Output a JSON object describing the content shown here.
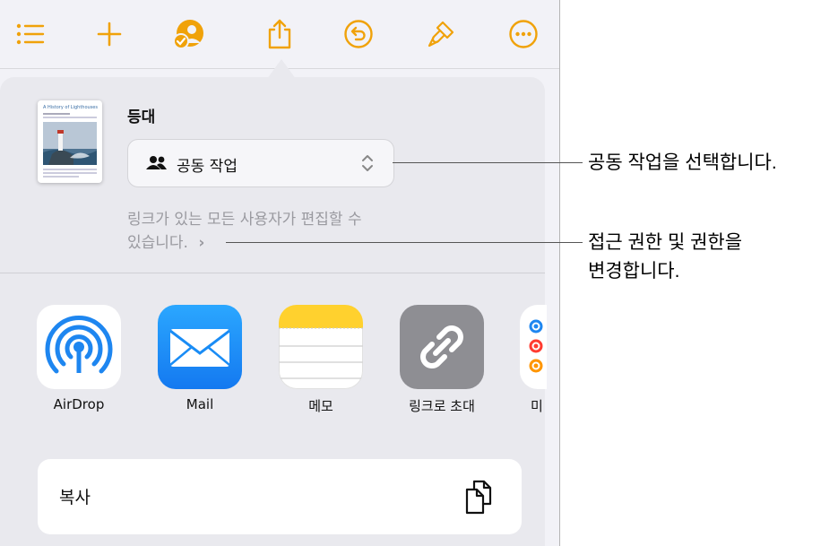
{
  "toolbar": {
    "icons": [
      "list-icon",
      "add-icon",
      "collaborate-icon",
      "share-icon",
      "undo-icon",
      "format-brush-icon",
      "more-icon"
    ],
    "accent": "#f0a20a"
  },
  "document": {
    "title": "등대",
    "thumbnail_heading": "A History of Lighthouses"
  },
  "collaboration": {
    "mode_label": "공동 작업"
  },
  "permissions": {
    "line1": "링크가 있는 모든 사용자가 편집할 수",
    "line2": "있습니다.",
    "chevron": "›"
  },
  "apps": [
    {
      "name": "AirDrop",
      "icon": "airdrop-icon"
    },
    {
      "name": "Mail",
      "icon": "mail-icon"
    },
    {
      "name": "메모",
      "icon": "notes-icon"
    },
    {
      "name": "링크로 초대",
      "icon": "link-icon"
    },
    {
      "name": "미",
      "icon": "reminders-icon"
    }
  ],
  "copy": {
    "label": "복사",
    "icon": "copy-icon"
  },
  "callouts": {
    "collab": "공동 작업을 선택합니다.",
    "access_line1": "접근 권한 및 권한을",
    "access_line2": "변경합니다."
  }
}
